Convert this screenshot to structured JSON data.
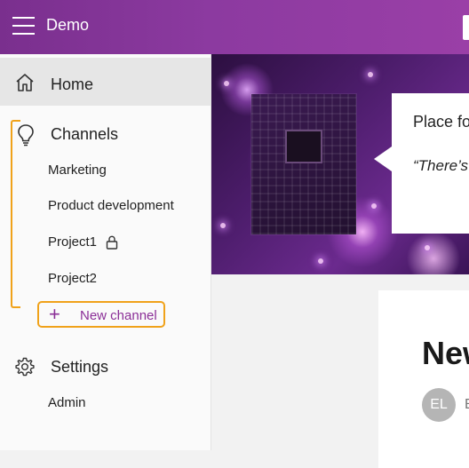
{
  "header": {
    "app_title": "Demo",
    "bg_colors": [
      "#7a2f8e",
      "#9a3fa7"
    ]
  },
  "sidebar": {
    "home": {
      "label": "Home",
      "icon": "home-icon"
    },
    "channels": {
      "label": "Channels",
      "icon": "lightbulb-icon",
      "items": [
        {
          "label": "Marketing"
        },
        {
          "label": "Product development"
        },
        {
          "label": "Project1",
          "locked": true
        },
        {
          "label": "Project2"
        }
      ],
      "new_channel_label": "New channel"
    },
    "settings": {
      "label": "Settings",
      "icon": "gear-icon",
      "items": [
        {
          "label": "Admin"
        }
      ]
    },
    "accent_color": "#f0a21a",
    "link_color": "#8b2f97"
  },
  "hero": {
    "card_title": "Place fo",
    "card_quote": "“There’s"
  },
  "content": {
    "title": "New",
    "author_initials": "EL",
    "author_name": "E"
  }
}
